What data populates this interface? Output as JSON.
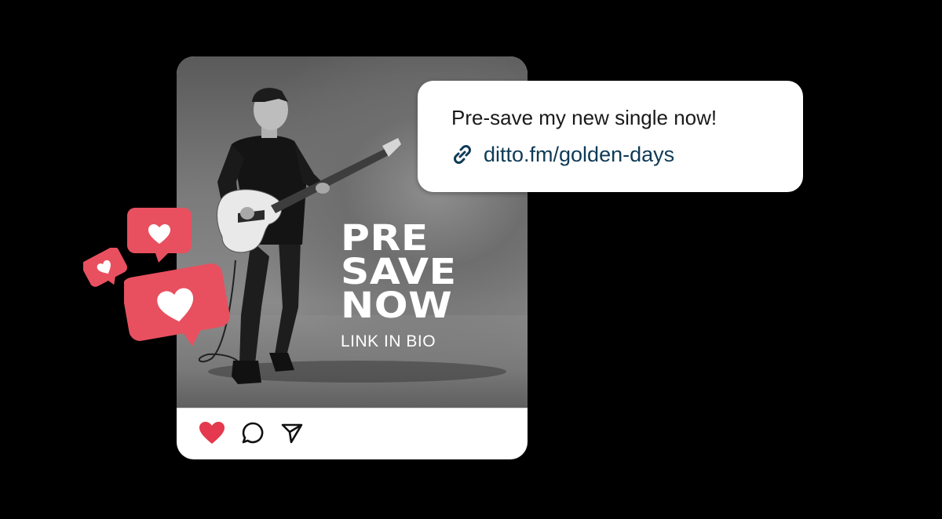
{
  "post": {
    "overlay_title_lines": [
      "PRE",
      "SAVE",
      "NOW"
    ],
    "overlay_subtitle": "LINK IN BIO",
    "actions": {
      "like_icon": "heart-icon",
      "comment_icon": "comment-icon",
      "share_icon": "send-icon",
      "like_color": "#e4394e"
    }
  },
  "bubble": {
    "message": "Pre-save my new single now!",
    "link_icon": "link-icon",
    "link_text": "ditto.fm/golden-days",
    "link_color": "#0e3a57"
  },
  "reactions": {
    "icon": "heart-icon",
    "color": "#e8505f"
  }
}
